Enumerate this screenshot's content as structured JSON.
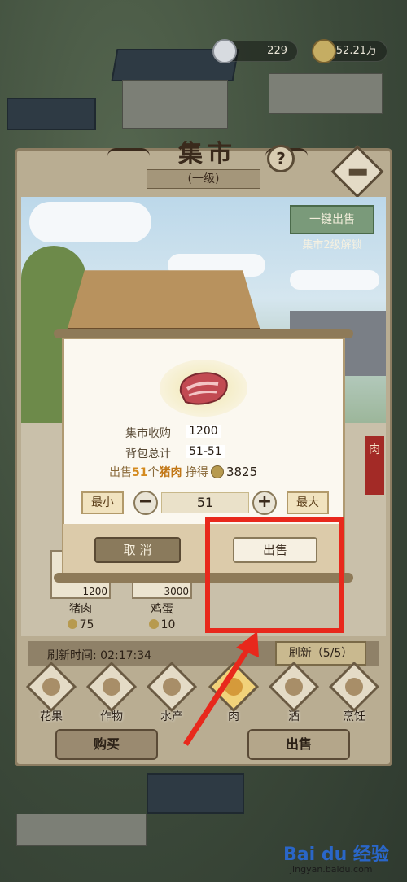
{
  "currency": {
    "bowls": "229",
    "coins": "52.21万"
  },
  "header": {
    "title": "集市",
    "level": "(一级)",
    "help": "?"
  },
  "scene": {
    "unlock_button": "一键出售",
    "unlock_text": "集市2级解锁"
  },
  "side_tag": "肉",
  "items": [
    {
      "name": "猪肉",
      "stock": "1200",
      "price": "75"
    },
    {
      "name": "鸡蛋",
      "stock": "3000",
      "price": "10"
    }
  ],
  "refresh": {
    "label": "刷新时间:",
    "time": "02:17:34",
    "button": "刷新（5/5）"
  },
  "categories": [
    "花果",
    "作物",
    "水产",
    "肉",
    "酒",
    "烹饪"
  ],
  "bottom": {
    "buy": "购买",
    "sell": "出售"
  },
  "dialog": {
    "market_buy_label": "集市收购",
    "market_buy_value": "1200",
    "bag_total_label": "背包总计",
    "bag_total_value": "51-51",
    "sell_prefix": "出售",
    "sell_count": "51",
    "sell_unit": "个",
    "sell_item": "猪肉",
    "earn_label": "挣得",
    "earn_value": "3825",
    "min_label": "最小",
    "max_label": "最大",
    "minus": "−",
    "plus": "+",
    "quantity": "51",
    "cancel": "取 消",
    "confirm": "出售"
  },
  "watermark": {
    "logo": "Bai du 经验",
    "url": "jingyan.baidu.com"
  },
  "colors": {
    "highlight": "#e8281c",
    "accent_orange": "#d48a1e"
  }
}
